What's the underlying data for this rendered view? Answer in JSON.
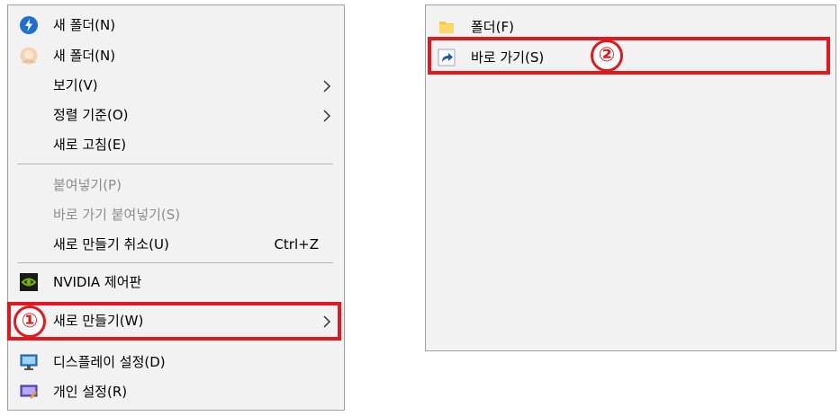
{
  "left_menu": {
    "items": [
      {
        "label": "새 폴더(N)",
        "icon": "blue-lightning-icon"
      },
      {
        "label": "새 폴더(N)",
        "icon": "avatar-icon"
      },
      {
        "label": "보기(V)",
        "has_submenu": true
      },
      {
        "label": "정렬 기준(O)",
        "has_submenu": true
      },
      {
        "label": "새로 고침(E)"
      },
      {
        "label": "붙여넣기(P)",
        "disabled": true
      },
      {
        "label": "바로 가기 붙여넣기(S)",
        "disabled": true
      },
      {
        "label": "새로 만들기 취소(U)",
        "shortcut": "Ctrl+Z"
      },
      {
        "label": "NVIDIA 제어판",
        "icon": "nvidia-icon"
      },
      {
        "label": "새로 만들기(W)",
        "has_submenu": true,
        "highlighted": true,
        "step": "①"
      },
      {
        "label": "디스플레이 설정(D)",
        "icon": "display-icon"
      },
      {
        "label": "개인 설정(R)",
        "icon": "personalize-icon"
      }
    ]
  },
  "right_menu": {
    "items": [
      {
        "label": "폴더(F)",
        "icon": "folder-icon"
      },
      {
        "label": "바로 가기(S)",
        "icon": "shortcut-icon",
        "highlighted": true,
        "step": "②"
      }
    ]
  },
  "colors": {
    "highlight": "#e0191f",
    "menu_bg": "#f2f2f2",
    "disabled_text": "#8d8d8d"
  }
}
